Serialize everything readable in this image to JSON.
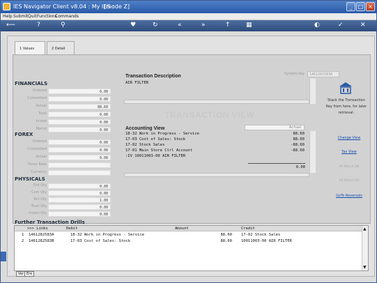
{
  "window": {
    "title": "IES Navigator Client v8.04 : My IES :",
    "mode": "[mode Z]",
    "minimize": "_",
    "maximize": "□",
    "close": "×"
  },
  "menu": [
    "Help",
    "Submit",
    "Quit",
    "Functions",
    "Commands"
  ],
  "toolbar_icons": [
    "back-arrow-icon",
    "help-icon",
    "search-icon",
    "heart-icon",
    "refresh-icon",
    "first-icon",
    "last-icon",
    "marker-icon",
    "calendar-icon",
    "globe-icon",
    "check-icon",
    "close-icon"
  ],
  "tabs": [
    {
      "label": "1 Values"
    },
    {
      "label": "2 Detail"
    }
  ],
  "financials": {
    "heading": "FINANCIALS",
    "fields": [
      {
        "label": "Ordered",
        "value": "0.00"
      },
      {
        "label": "Committed",
        "value": "0.00"
      },
      {
        "label": "Actual",
        "value": "88.60"
      },
      {
        "label": "Trust",
        "value": "0.00"
      },
      {
        "label": "Invest",
        "value": "0.00"
      },
      {
        "label": "Memo",
        "value": "0.00"
      }
    ]
  },
  "forex": {
    "heading": "FOREX",
    "fields": [
      {
        "label": "Ordered",
        "value": "0.00"
      },
      {
        "label": "Committed",
        "value": "0.00"
      },
      {
        "label": "Actual",
        "value": "0.00"
      },
      {
        "label": "Forex Rate",
        "value": ""
      },
      {
        "label": "Currency",
        "value": ""
      }
    ]
  },
  "physicals": {
    "heading": "PHYSICALS",
    "fields": [
      {
        "label": "Ord Qty",
        "value": "0.00"
      },
      {
        "label": "Com Qty",
        "value": "0.00"
      },
      {
        "label": "Act Qty",
        "value": "1.00"
      },
      {
        "label": "Trust Qty",
        "value": "0.00"
      },
      {
        "label": "Invest Qty",
        "value": "0.00"
      }
    ]
  },
  "transaction": {
    "description_label": "Transaction Description",
    "description": "AIR FILTER",
    "system_key_label": "System key",
    "system_key": "1461282583A",
    "view_title": "TRANSACTION VIEW",
    "accounting_label": "Accounting View",
    "actual_label": "Actual",
    "lines": [
      {
        "text": "18-32 Work in Progress - Service",
        "amount": "88.60"
      },
      {
        "text": "17-03 Cost of Sales: Stock",
        "amount": "88.60"
      },
      {
        "text": "17-02 Stock Sales",
        "amount": "-88.60"
      },
      {
        "text": "17-01 Main Store Ctrl Account",
        "amount": "-88.60"
      },
      {
        "text": ":IV  10011003-00 AIR FILTER",
        "amount": ""
      }
    ],
    "total": "0.00"
  },
  "right_panel": {
    "stack_text": "Stack the Transaction Key from here, for later retrieval.",
    "change_view": "Change View",
    "tax_view": "Tax View",
    "ap_match": "AP Match Dtl",
    "ar_match": "AR Match Dtl",
    "goto_reversals": "GoTo Reversals"
  },
  "drills": {
    "title": "Further Transaction Drills",
    "columns": [
      ">>> Links",
      "Debit",
      "Amount",
      "Credit"
    ],
    "rows": [
      {
        "num": "1",
        "link": "1461282583A",
        "debit": "18-32 Work in Progress - Service",
        "amount": "88.60",
        "credit": "17-02 Stock Sales"
      },
      {
        "num": "2",
        "link": "1461282583B",
        "debit": "17-03 Cost of Sales: Stock",
        "amount": "88.60",
        "credit": "10011003-00 AIR FILTER"
      }
    ]
  },
  "bottom_buttons": [
    "Ver",
    "Ere"
  ]
}
